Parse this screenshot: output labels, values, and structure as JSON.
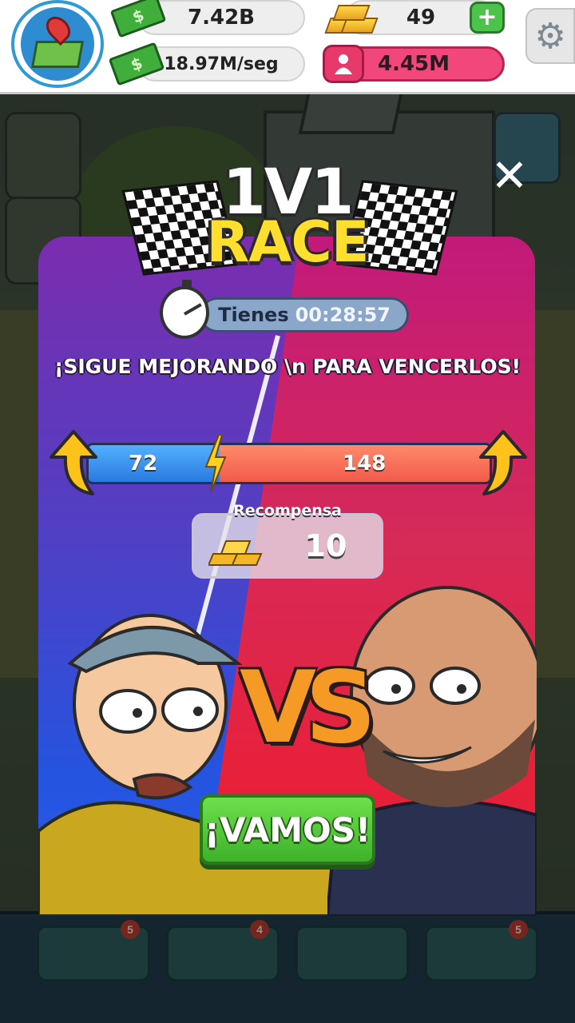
{
  "hud": {
    "money": "7.42B",
    "income_rate": "18.97M/seg",
    "gold": "49",
    "add_label": "+",
    "fans": "4.45M"
  },
  "modal": {
    "title_top": "1V1",
    "title_bottom": "RACE",
    "close_label": "✕",
    "timer_label": "Tienes",
    "timer_value": "00:28:57",
    "message": "¡SIGUE MEJORANDO \\n PARA VENCERLOS!",
    "player_score": 72,
    "opponent_score": 148,
    "reward_label": "Recompensa",
    "reward_value": "10",
    "vs_label": "VS",
    "go_button_label": "¡VAMOS!"
  },
  "dock": {
    "badges": [
      "5",
      "4",
      "5"
    ]
  },
  "colors": {
    "player_bar": "#3a8ef0",
    "opponent_bar": "#f26a55",
    "go_button": "#4cc83a",
    "title_race": "#ffdf2e"
  }
}
